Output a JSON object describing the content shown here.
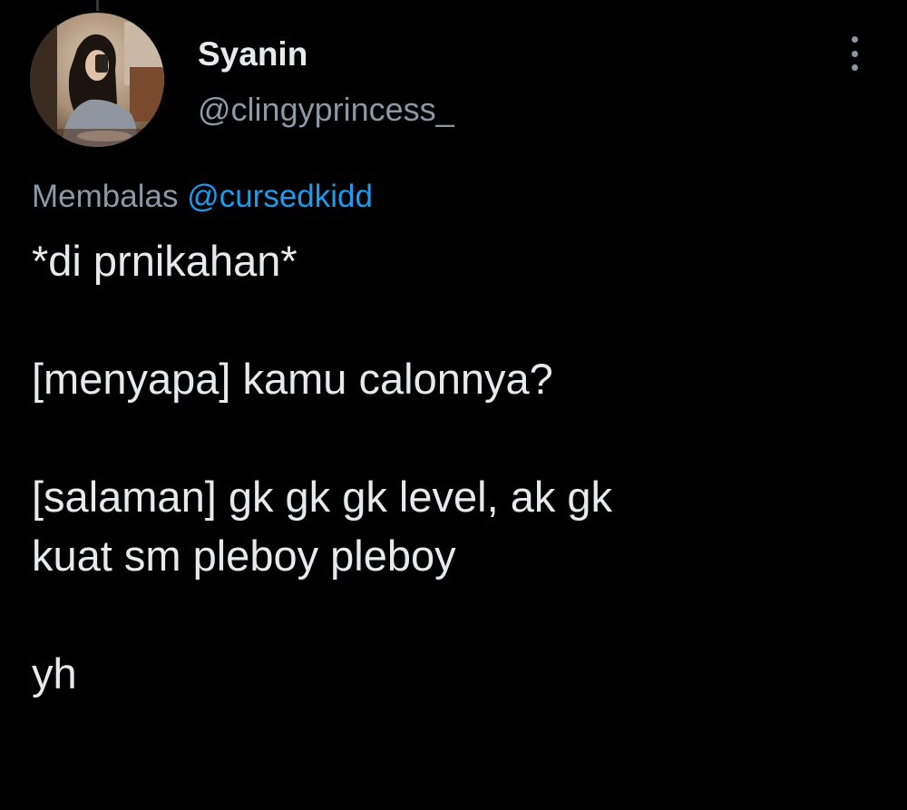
{
  "tweet": {
    "author": {
      "display_name": "Syanin",
      "handle": "@clingyprincess_",
      "avatar_icon": "profile-photo"
    },
    "reply_prefix": "Membalas",
    "reply_to": "@cursedkidd",
    "lines": [
      "*di prnikahan*",
      "",
      "[menyapa] kamu calonnya?",
      "",
      "[salaman] gk gk gk level, ak gk",
      "kuat sm pleboy pleboy",
      "",
      "yh"
    ],
    "more_icon": "more-vertical-icon"
  },
  "colors": {
    "background": "#000000",
    "text_primary": "#e7e9ea",
    "text_secondary": "#8b98a5",
    "accent": "#1d9bf0"
  }
}
